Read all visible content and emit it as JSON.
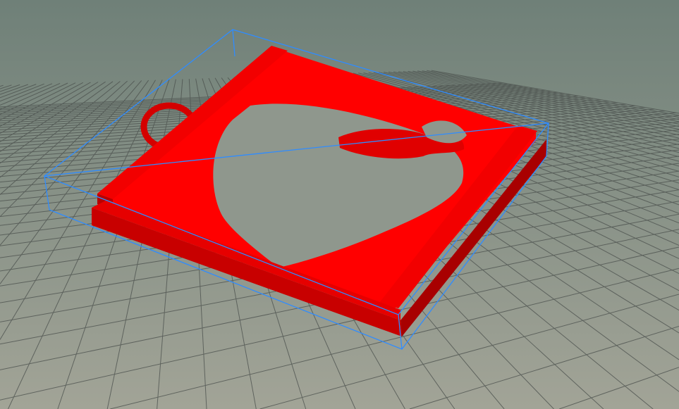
{
  "viewport": {
    "colors": {
      "background_top": "#6f8078",
      "background_bottom": "#a2a497",
      "grid_line": "#4a4f4c",
      "model_top": "#ff0000",
      "model_side": "#cc0000",
      "model_shadow": "#990000",
      "bounding_box": "#2f8cff"
    },
    "model_name_icon": "3d-model-object",
    "bounding_box_icon": "selection-bounding-box"
  }
}
